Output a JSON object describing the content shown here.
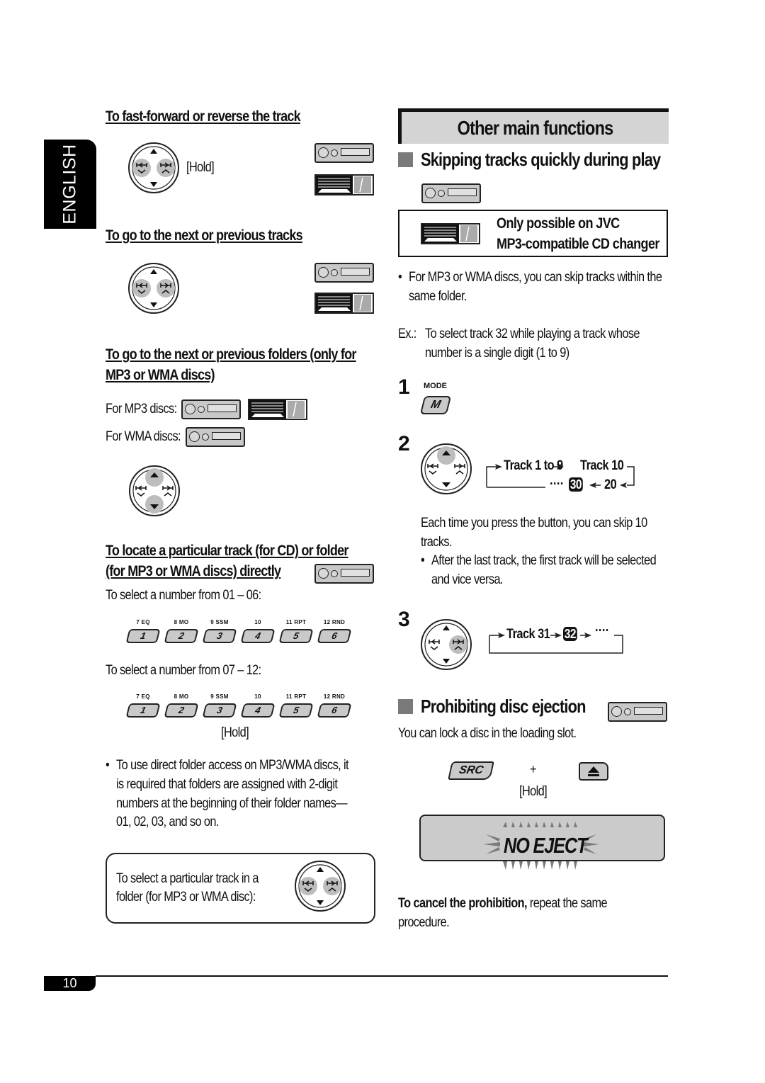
{
  "language_tab": "ENGLISH",
  "page_number": "10",
  "left": {
    "ff_title": "To fast-forward or reverse the track",
    "ff_hold": "[Hold]",
    "next_prev_title": "To go to the next or previous tracks",
    "folders_title_line1": "To go to the next or previous folders (only for",
    "folders_title_line2": "MP3 or WMA discs)",
    "for_mp3": "For MP3 discs:",
    "for_wma": "For WMA discs:",
    "locate_title_line1": "To locate a particular track (for CD) or folder",
    "locate_title_line2": "(for MP3 or WMA discs) directly",
    "select_01_06": "To select a number from 01 – 06:",
    "select_07_12": "To select a number from 07 – 12:",
    "number_buttons": [
      {
        "label": "7 EQ",
        "key": "1"
      },
      {
        "label": "8 MO",
        "key": "2"
      },
      {
        "label": "9 SSM",
        "key": "3"
      },
      {
        "label": "10",
        "key": "4"
      },
      {
        "label": "11 RPT",
        "key": "5"
      },
      {
        "label": "12 RND",
        "key": "6"
      }
    ],
    "hold2": "[Hold]",
    "bullet_lines": [
      "To use direct folder access on MP3/WMA discs, it",
      "is required that folders are assigned with 2-digit",
      "numbers at the beginning of their folder names—",
      "01, 02, 03, and so on."
    ],
    "box_line1": "To select a particular track in a",
    "box_line2": "folder (for MP3 or WMA disc):"
  },
  "right": {
    "section_title": "Other main functions",
    "skip_title": "Skipping tracks quickly during play",
    "note_line1": "Only possible on JVC",
    "note_line2": "MP3-compatible CD changer",
    "bullet1_line1": "For MP3 or WMA discs, you can skip tracks within the",
    "bullet1_line2": "same folder.",
    "ex_label": "Ex.:",
    "ex_line1": "To select track 32 while playing a track whose",
    "ex_line2": "number is a single digit (1 to 9)",
    "step1": "1",
    "mode_label": "MODE",
    "mode_key": "M",
    "step2": "2",
    "flow2_a": "Track 1 to 9",
    "flow2_b": "Track 10",
    "flow2_c": "20",
    "flow2_d": "30",
    "flow2_dots": "····",
    "each_line1": "Each time you press the button, you can skip 10",
    "each_line2": "tracks.",
    "bullet2_line1": "After the last track, the first track will be selected",
    "bullet2_line2": "and vice versa.",
    "step3": "3",
    "flow3_a": "Track 31",
    "flow3_b": "32",
    "flow3_dots": "····",
    "prohibit_title": "Prohibiting disc ejection",
    "lock_text": "You can lock a disc in the loading slot.",
    "src_key": "SRC",
    "plus": "+",
    "hold3": "[Hold]",
    "lcd_text": "NO EJECT",
    "cancel_bold": "To cancel the prohibition,",
    "cancel_rest": " repeat the same",
    "cancel_line2": "procedure."
  }
}
